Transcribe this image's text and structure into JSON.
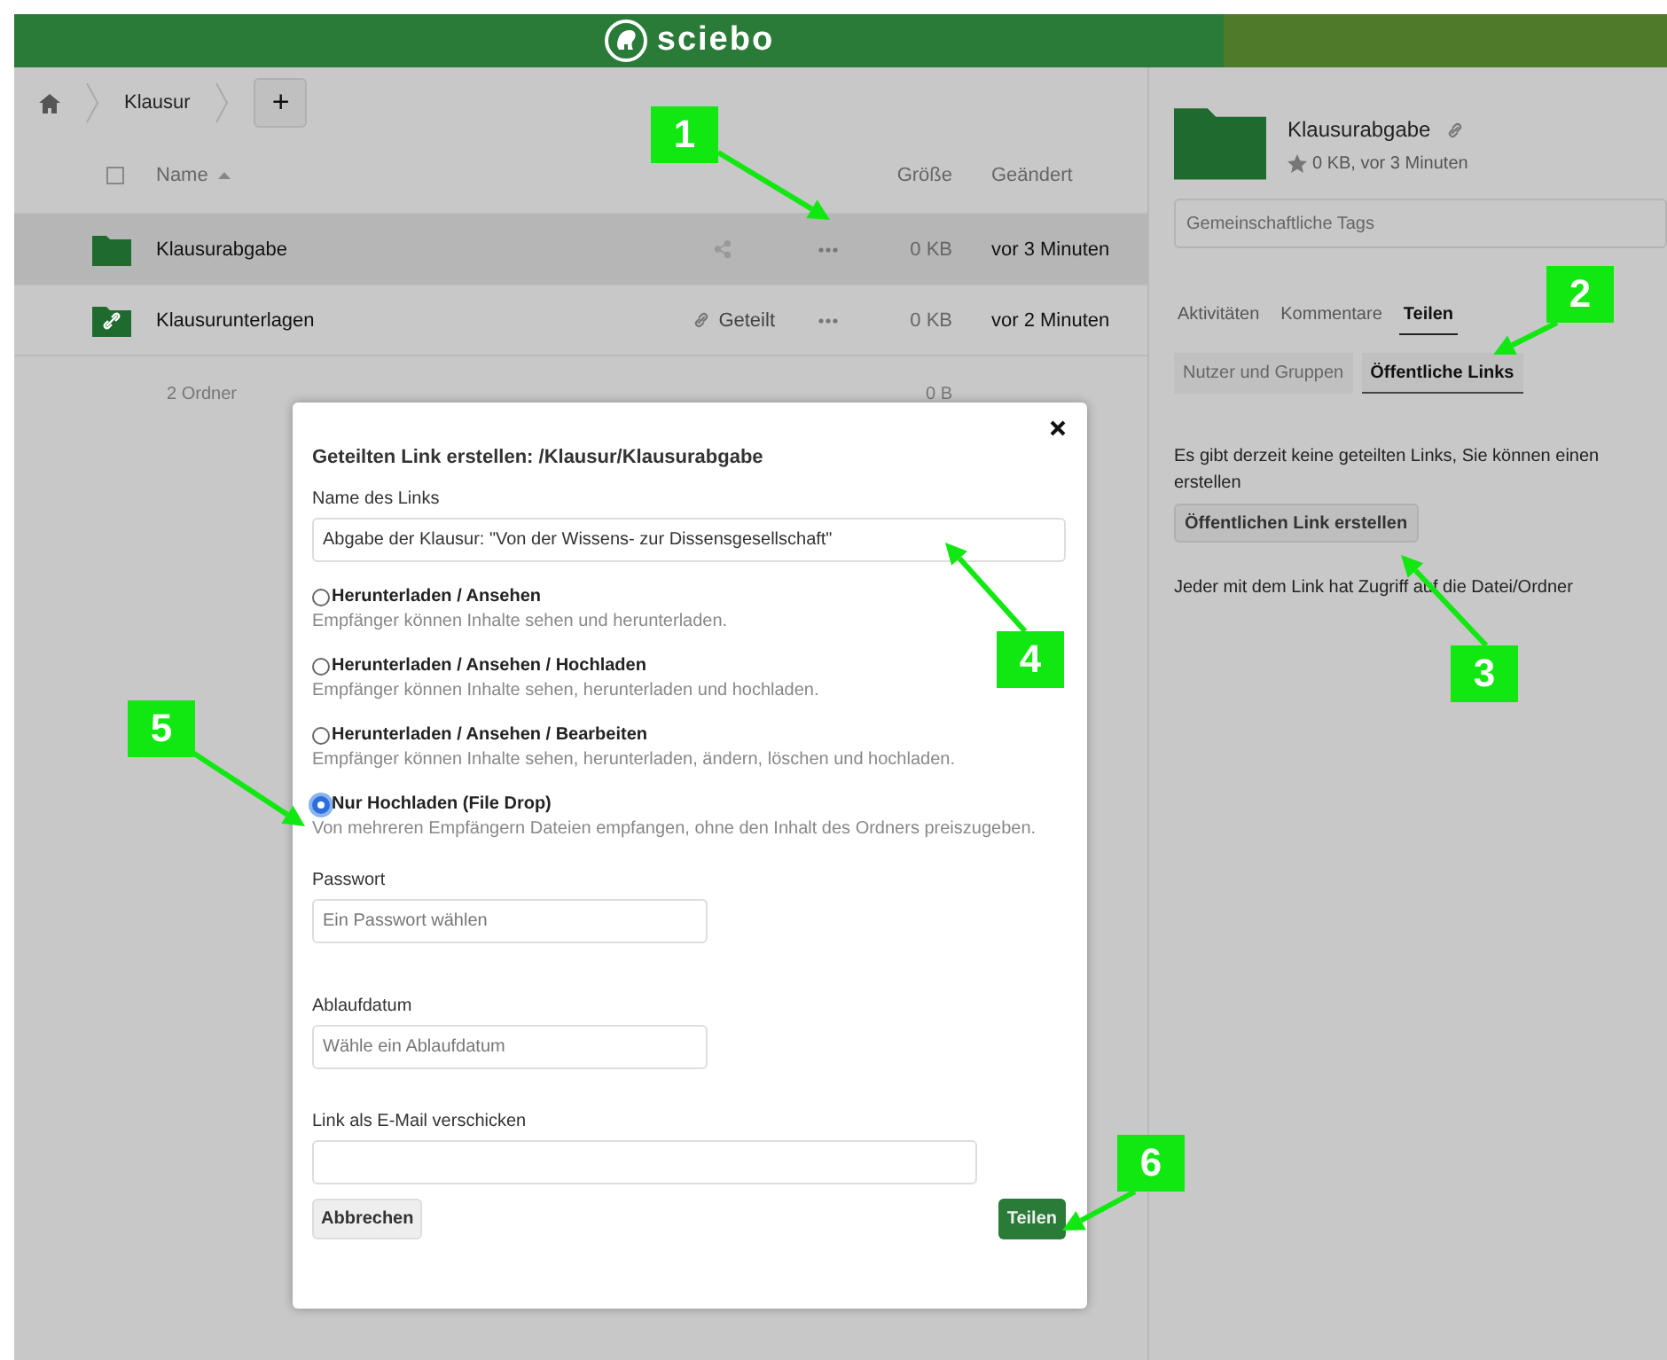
{
  "header": {
    "logo": "sciebo"
  },
  "breadcrumb": {
    "items": [
      "Klausur"
    ],
    "add_button": "+"
  },
  "file_table": {
    "select_all": {
      "checked": false
    },
    "columns": [
      "Name",
      "Größe",
      "Geändert"
    ],
    "rows": [
      {
        "kind": "folder",
        "name": "Klausurabgabe",
        "size": "0 KB",
        "modified": "vor 3 Minuten",
        "selected": true
      },
      {
        "kind": "shared-folder",
        "name": "Klausurunterlagen",
        "shared_label": "Geteilt",
        "size": "0 KB",
        "modified": "vor 2 Minuten",
        "selected": false
      }
    ],
    "summary": {
      "count": "2 Ordner",
      "size": "0 B"
    }
  },
  "details": {
    "title": "Klausurabgabe",
    "meta": "0 KB, vor 3 Minuten",
    "tags_placeholder": "Gemeinschaftliche Tags",
    "tabs": [
      {
        "label": "Aktivitäten",
        "selected": false
      },
      {
        "label": "Kommentare",
        "selected": false
      },
      {
        "label": "Teilen",
        "selected": true
      }
    ],
    "subtabs": [
      {
        "label": "Nutzer und Gruppen",
        "selected": false
      },
      {
        "label": "Öffentliche Links",
        "selected": true
      }
    ],
    "message": "Es gibt derzeit keine geteilten Links, Sie können einen erstellen",
    "create_button": "Öffentlichen Link erstellen",
    "note": "Jeder mit dem Link hat Zugriff auf die Datei/Ordner"
  },
  "dialog": {
    "title": "Geteilten Link erstellen: /Klausur/Klausurabgabe",
    "name_label": "Name des Links",
    "name_value": "Abgabe der Klausur: \"Von der Wissens- zur Dissensgesellschaft\"",
    "options": [
      {
        "label": "Herunterladen / Ansehen",
        "description": "Empfänger können Inhalte sehen und herunterladen.",
        "selected": false
      },
      {
        "label": "Herunterladen / Ansehen / Hochladen",
        "description": "Empfänger können Inhalte sehen, herunterladen und hochladen.",
        "selected": false
      },
      {
        "label": "Herunterladen / Ansehen / Bearbeiten",
        "description": "Empfänger können Inhalte sehen, herunterladen, ändern, löschen und hochladen.",
        "selected": false
      },
      {
        "label": "Nur Hochladen (File Drop)",
        "description": "Von mehreren Empfängern Dateien empfangen, ohne den Inhalt des Ordners preiszugeben.",
        "selected": true
      }
    ],
    "password_label": "Passwort",
    "password_placeholder": "Ein Passwort wählen",
    "expiry_label": "Ablaufdatum",
    "expiry_placeholder": "Wähle ein Ablaufdatum",
    "email_label": "Link als E-Mail verschicken",
    "cancel_button": "Abbrechen",
    "submit_button": "Teilen"
  },
  "callouts": [
    "1",
    "2",
    "3",
    "4",
    "5",
    "6"
  ]
}
